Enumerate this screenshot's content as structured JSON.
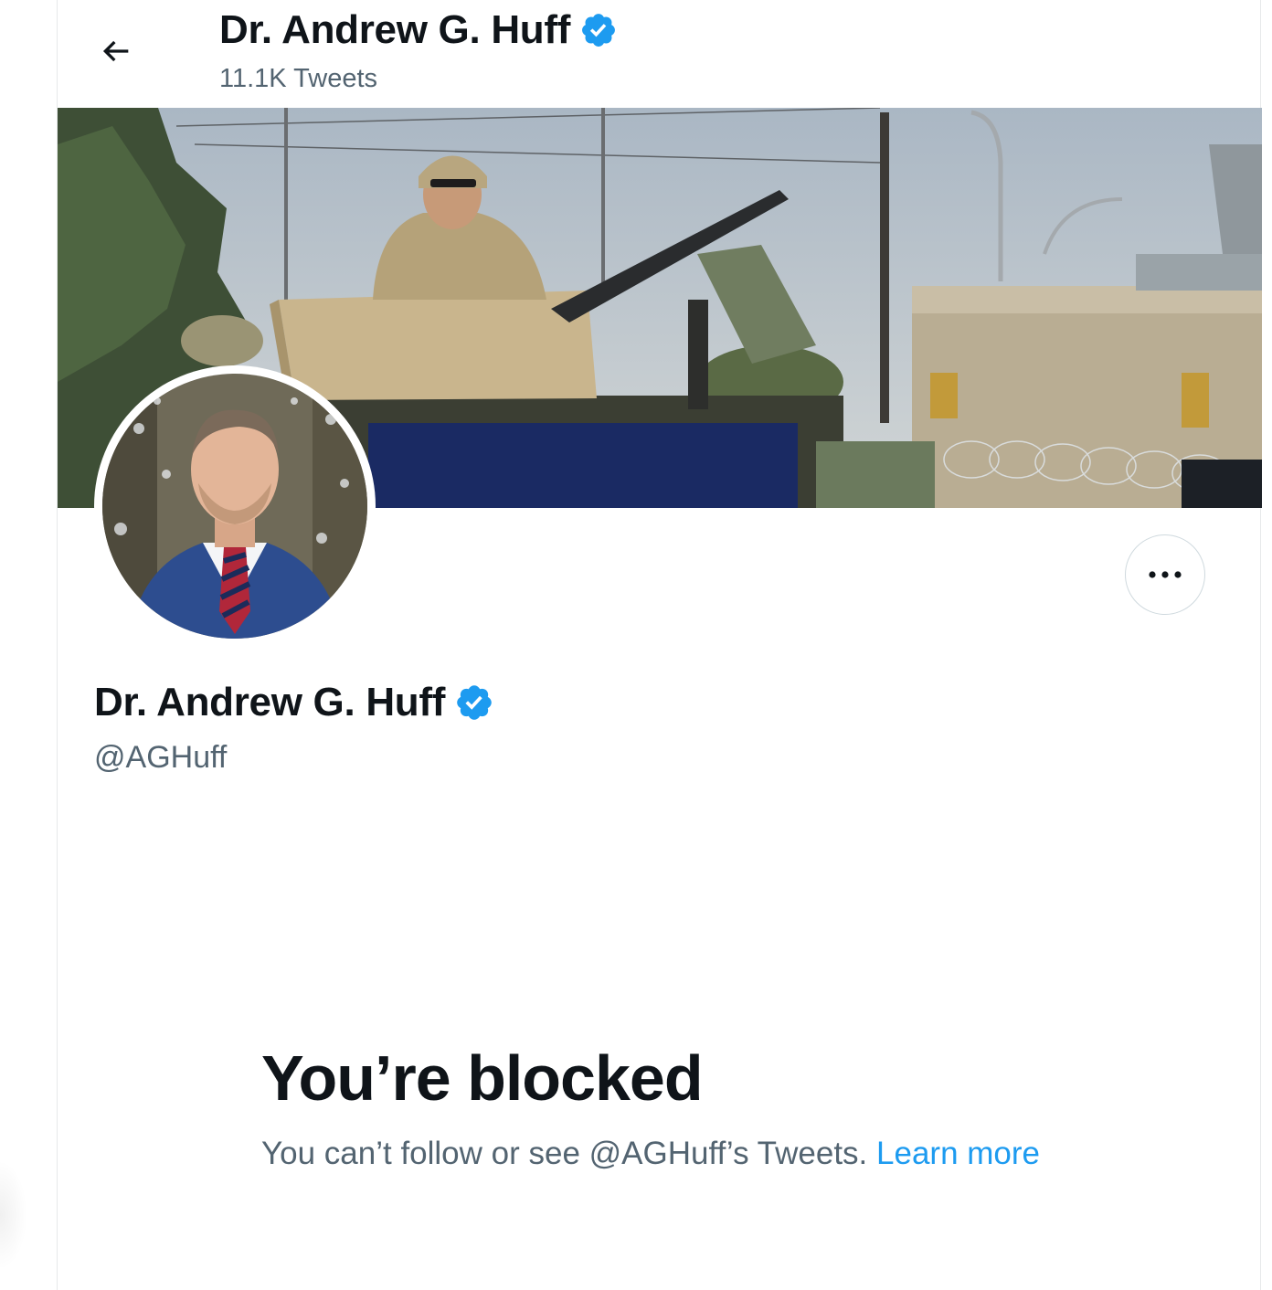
{
  "header": {
    "back_icon": "arrow-left-icon",
    "title": "Dr. Andrew G. Huff",
    "tweet_count": "11.1K Tweets",
    "verified_icon": "verified-badge-icon"
  },
  "profile": {
    "name": "Dr. Andrew G. Huff",
    "handle": "@AGHuff",
    "more_icon": "more-horizontal-icon"
  },
  "blocked": {
    "title": "You’re blocked",
    "message": "You can’t follow or see @AGHuff’s Tweets.",
    "learn_more": "Learn more"
  },
  "colors": {
    "accent": "#1d9bf0",
    "text_primary": "#0f1419",
    "text_secondary": "#536471"
  }
}
